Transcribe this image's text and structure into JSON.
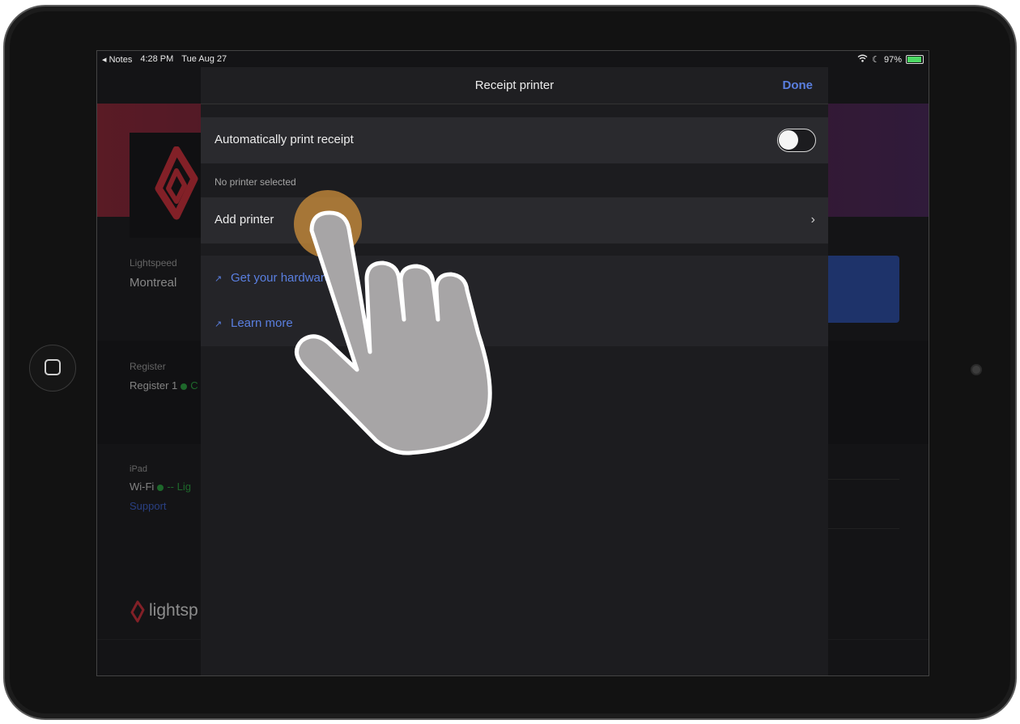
{
  "status_bar": {
    "back_app": "◂ Notes",
    "time": "4:28 PM",
    "date": "Tue Aug 27",
    "battery": "97%"
  },
  "background_app": {
    "location_label": "Lightspeed",
    "location_value": "Montreal",
    "register_label": "Register",
    "register_value": "Register 1",
    "register_status": "C",
    "ipad_label": "iPad",
    "wifi_label": "Wi-Fi",
    "wifi_status": "-- Lig",
    "support_link": "Support",
    "brand": "lightsp"
  },
  "modal": {
    "title": "Receipt printer",
    "done_label": "Done",
    "auto_print_label": "Automatically print receipt",
    "auto_print_on": false,
    "no_printer_note": "No printer selected",
    "add_printer_label": "Add printer",
    "links": [
      {
        "label": "Get your hardware",
        "icon": "external-arrow-icon"
      },
      {
        "label": "Learn more",
        "icon": "external-arrow-icon"
      }
    ]
  },
  "colors": {
    "accent": "#5a7fe0",
    "brand_red": "#c8323c",
    "status_green": "#2ea043"
  }
}
